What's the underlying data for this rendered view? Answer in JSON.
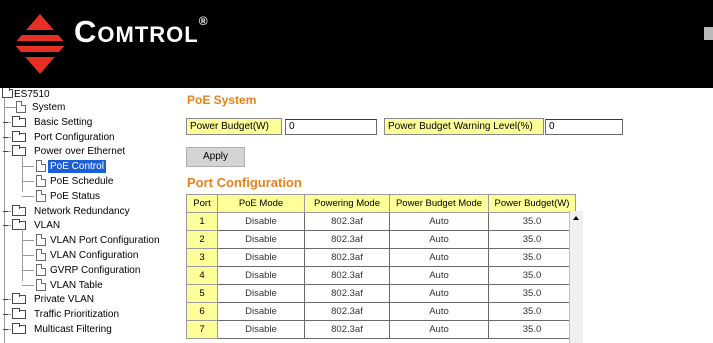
{
  "header": {
    "brand": "Comtrol",
    "trademark": "®",
    "accent_color": "#e63025"
  },
  "tree": {
    "root": "ES7510",
    "items": [
      {
        "label": "System",
        "kind": "doc",
        "level": 1
      },
      {
        "label": "Basic Setting",
        "kind": "folder",
        "level": 1
      },
      {
        "label": "Port Configuration",
        "kind": "folder",
        "level": 1
      },
      {
        "label": "Power over Ethernet",
        "kind": "folder",
        "level": 1,
        "expanded": true
      },
      {
        "label": "PoE Control",
        "kind": "doc",
        "level": 2,
        "selected": true
      },
      {
        "label": "PoE Schedule",
        "kind": "doc",
        "level": 2
      },
      {
        "label": "PoE Status",
        "kind": "doc",
        "level": 2
      },
      {
        "label": "Network Redundancy",
        "kind": "folder",
        "level": 1
      },
      {
        "label": "VLAN",
        "kind": "folder",
        "level": 1,
        "expanded": true
      },
      {
        "label": "VLAN Port Configuration",
        "kind": "doc",
        "level": 2
      },
      {
        "label": "VLAN Configuration",
        "kind": "doc",
        "level": 2
      },
      {
        "label": "GVRP Configuration",
        "kind": "doc",
        "level": 2
      },
      {
        "label": "VLAN Table",
        "kind": "doc",
        "level": 2
      },
      {
        "label": "Private VLAN",
        "kind": "folder",
        "level": 1
      },
      {
        "label": "Traffic Prioritization",
        "kind": "folder",
        "level": 1
      },
      {
        "label": "Multicast Filtering",
        "kind": "folder",
        "level": 1
      }
    ],
    "selected_color": "#1a5fd6"
  },
  "poe_system": {
    "title": "PoE System",
    "power_budget_label": "Power Budget(W)",
    "power_budget_value": "0",
    "warning_label": "Power Budget Warning Level(%)",
    "warning_value": "0",
    "apply_label": "Apply"
  },
  "port_config": {
    "title": "Port Configuration",
    "columns": [
      "Port",
      "PoE Mode",
      "Powering Mode",
      "Power Budget Mode",
      "Power Budget(W)"
    ],
    "rows": [
      [
        "1",
        "Disable",
        "802.3af",
        "Auto",
        "35.0"
      ],
      [
        "2",
        "Disable",
        "802.3af",
        "Auto",
        "35.0"
      ],
      [
        "3",
        "Disable",
        "802.3af",
        "Auto",
        "35.0"
      ],
      [
        "4",
        "Disable",
        "802.3af",
        "Auto",
        "35.0"
      ],
      [
        "5",
        "Disable",
        "802.3af",
        "Auto",
        "35.0"
      ],
      [
        "6",
        "Disable",
        "802.3af",
        "Auto",
        "35.0"
      ],
      [
        "7",
        "Disable",
        "802.3af",
        "Auto",
        "35.0"
      ]
    ]
  },
  "colors": {
    "title": "#e8821e",
    "field_bg": "#ffff99",
    "header_bg": "#000000"
  }
}
